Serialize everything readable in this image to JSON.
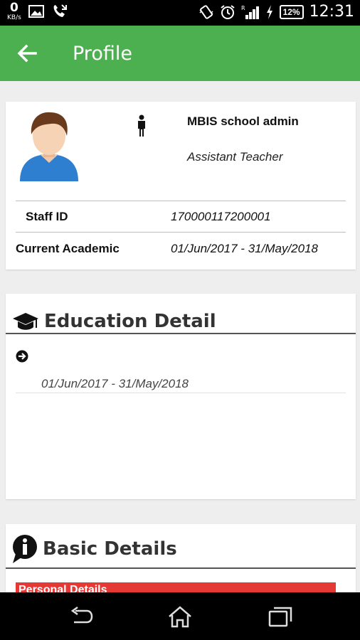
{
  "status_bar": {
    "net_speed_value": "0",
    "net_speed_unit": "KB/s",
    "battery": "12%",
    "time": "12:31"
  },
  "app_bar": {
    "title": "Profile",
    "back_icon": "arrow-left-icon"
  },
  "profile": {
    "name": "MBIS school admin",
    "role": "Assistant Teacher",
    "staff_id_label": "Staff ID",
    "staff_id_value": "170000117200001",
    "academic_label": "Current Academic",
    "academic_value": "01/Jun/2017 - 31/May/2018"
  },
  "education": {
    "title": "Education Detail",
    "icon": "graduation-cap-icon",
    "items": [
      {
        "date": "01/Jun/2017 - 31/May/2018"
      }
    ]
  },
  "basic": {
    "title": "Basic Details",
    "icon": "info-icon",
    "personal_label": "Personal Details",
    "personal_color": "#e53935"
  },
  "colors": {
    "primary": "#4caf50",
    "background": "#eeeeee"
  }
}
